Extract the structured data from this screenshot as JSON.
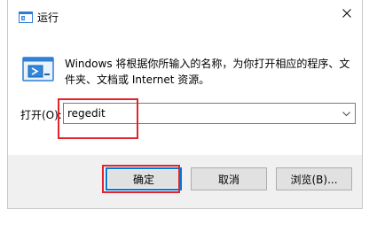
{
  "window": {
    "title": "运行",
    "description": "Windows 将根据你所输入的名称，为你打开相应的程序、文件夹、文档或 Internet 资源。"
  },
  "open_field": {
    "label": "打开(O):",
    "value": "regedit"
  },
  "buttons": {
    "ok": "确定",
    "cancel": "取消",
    "browse": "浏览(B)..."
  },
  "icons": {
    "title": "run-icon",
    "dialog": "run-icon",
    "close": "close-icon",
    "dropdown": "chevron-down-icon"
  },
  "colors": {
    "highlight": "#e3232d",
    "default_button_border": "#0078d7",
    "footer_background": "#f0f0f0"
  }
}
